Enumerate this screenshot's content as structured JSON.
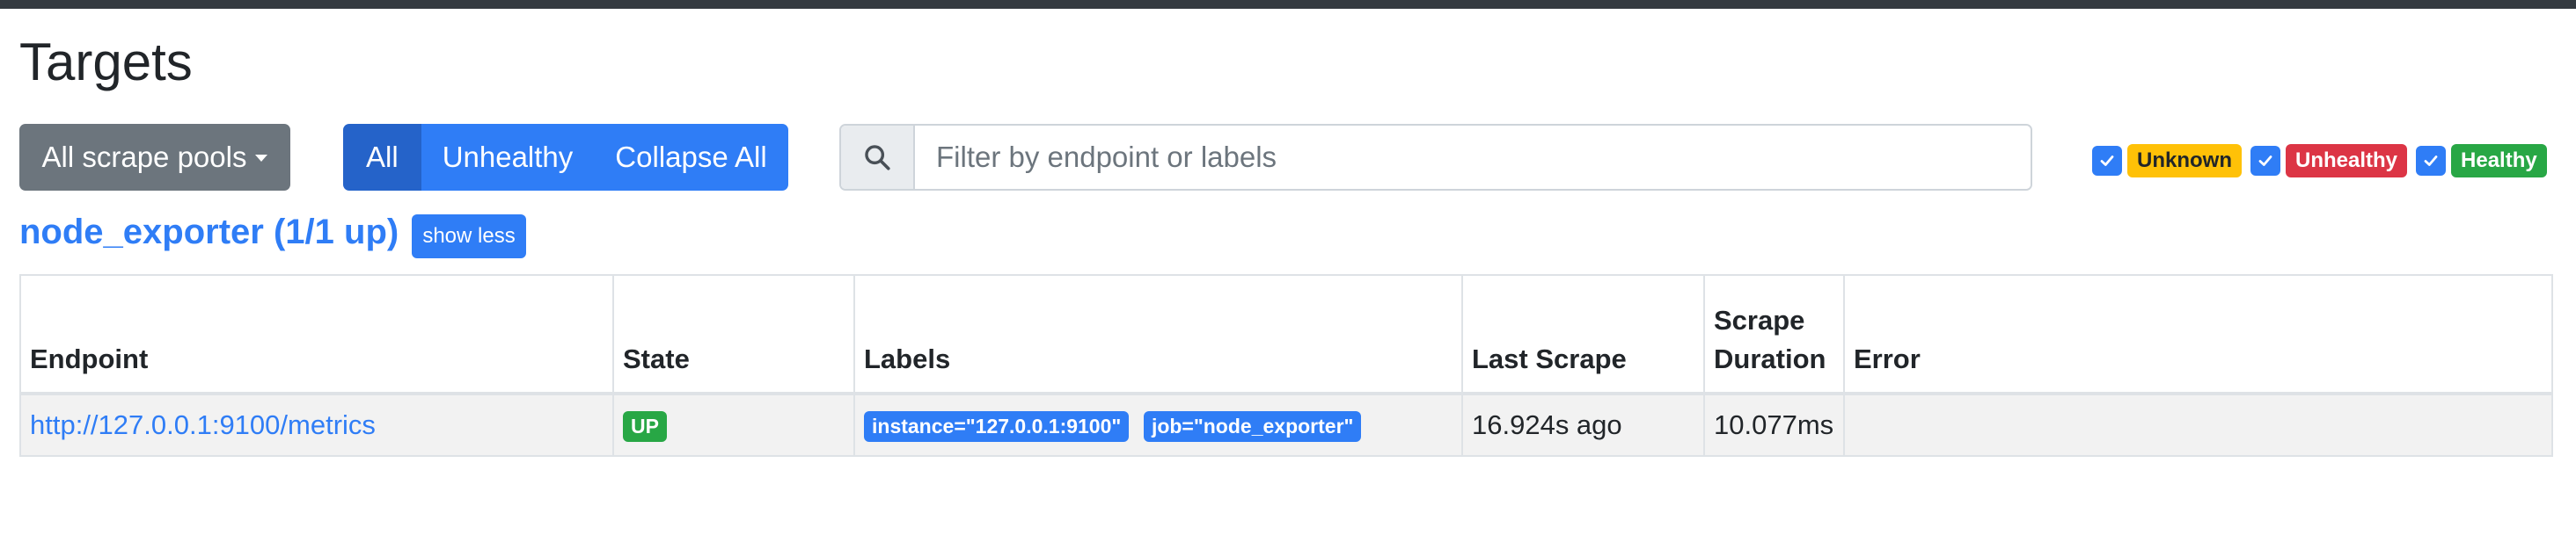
{
  "page": {
    "title": "Targets"
  },
  "toolbar": {
    "scrape_pools_label": "All scrape pools",
    "btn_all": "All",
    "btn_unhealthy": "Unhealthy",
    "btn_collapse": "Collapse All",
    "search_placeholder": "Filter by endpoint or labels"
  },
  "filters": [
    {
      "label": "Unknown",
      "checked": true,
      "color": "#ffc107"
    },
    {
      "label": "Unhealthy",
      "checked": true,
      "color": "#dc3545"
    },
    {
      "label": "Healthy",
      "checked": true,
      "color": "#28a745"
    }
  ],
  "pool": {
    "title": "node_exporter (1/1 up)",
    "toggle_label": "show less",
    "columns": [
      "Endpoint",
      "State",
      "Labels",
      "Last Scrape",
      "Scrape Duration",
      "Error"
    ],
    "rows": [
      {
        "endpoint": "http://127.0.0.1:9100/metrics",
        "state": "UP",
        "labels": [
          "instance=\"127.0.0.1:9100\"",
          "job=\"node_exporter\""
        ],
        "last_scrape": "16.924s ago",
        "duration": "10.077ms",
        "error": ""
      }
    ]
  },
  "colors": {
    "primary": "#2f7df6",
    "secondary": "#6c757d",
    "success": "#28a745",
    "danger": "#dc3545",
    "warning": "#ffc107"
  }
}
